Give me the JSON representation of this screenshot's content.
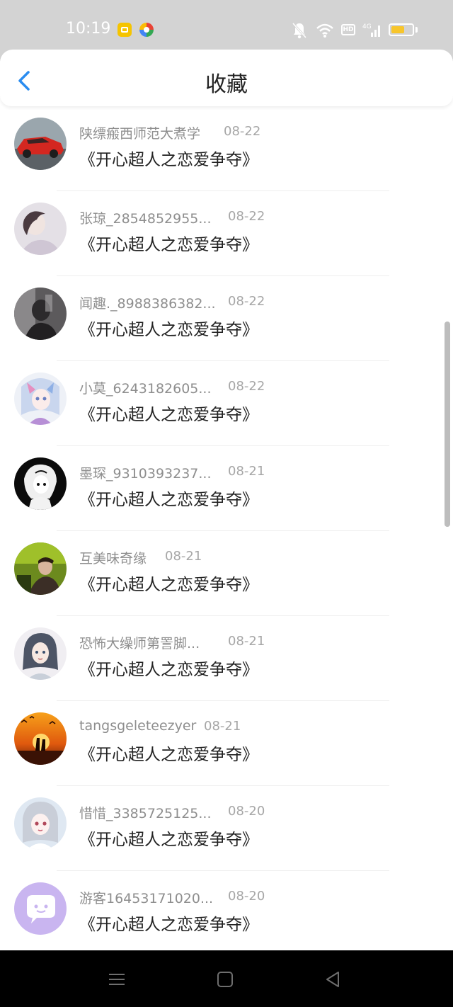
{
  "status_bar": {
    "time": "10:19",
    "icons": [
      "notes-app-icon",
      "browser-app-icon",
      "mute-icon",
      "wifi-icon",
      "hd-icon",
      "signal-4g-icon",
      "battery-icon"
    ],
    "hd_label": "HD",
    "signal_label": "4G",
    "battery_level": 0.65,
    "battery_color": "#f7c52b"
  },
  "header": {
    "title": "收藏",
    "back_icon": "back-arrow-icon",
    "accent_color": "#2a8cf0"
  },
  "favorites": [
    {
      "user": "陕缥瘢西师范大煮学",
      "date": "08-22",
      "title": "《开心超人之恋爱争夺》",
      "avatar": "red-car-avatar"
    },
    {
      "user": "张琼_2854852955...",
      "date": "08-22",
      "title": "《开心超人之恋爱争夺》",
      "avatar": "woman-photo-avatar"
    },
    {
      "user": "闻趣._8988386382...",
      "date": "08-22",
      "title": "《开心超人之恋爱争夺》",
      "avatar": "dark-photo-avatar"
    },
    {
      "user": "小莫_6243182605...",
      "date": "08-22",
      "title": "《开心超人之恋爱争夺》",
      "avatar": "anime-girl-avatar"
    },
    {
      "user": "墨琛_9310393237...",
      "date": "08-21",
      "title": "《开心超人之恋爱争夺》",
      "avatar": "black-white-anime-avatar"
    },
    {
      "user": "互美味奇缘",
      "date": "08-21",
      "title": "《开心超人之恋爱争夺》",
      "avatar": "green-photo-avatar"
    },
    {
      "user": "恐怖大缲师第詈脚...",
      "date": "08-21",
      "title": "《开心超人之恋爱争夺》",
      "avatar": "illustration-girl-avatar"
    },
    {
      "user": "tangsgeleteezyer",
      "date": "08-21",
      "title": "《开心超人之恋爱争夺》",
      "avatar": "sunset-couple-avatar"
    },
    {
      "user": "惜惜_3385725125...",
      "date": "08-20",
      "title": "《开心超人之恋爱争夺》",
      "avatar": "anime-portrait-avatar"
    },
    {
      "user": "游客16453171020...",
      "date": "08-20",
      "title": "《开心超人之恋爱争夺》",
      "avatar": "default-chat-avatar"
    }
  ],
  "nav_bar": {
    "buttons": [
      "menu-icon",
      "home-icon",
      "back-triangle-icon"
    ]
  }
}
